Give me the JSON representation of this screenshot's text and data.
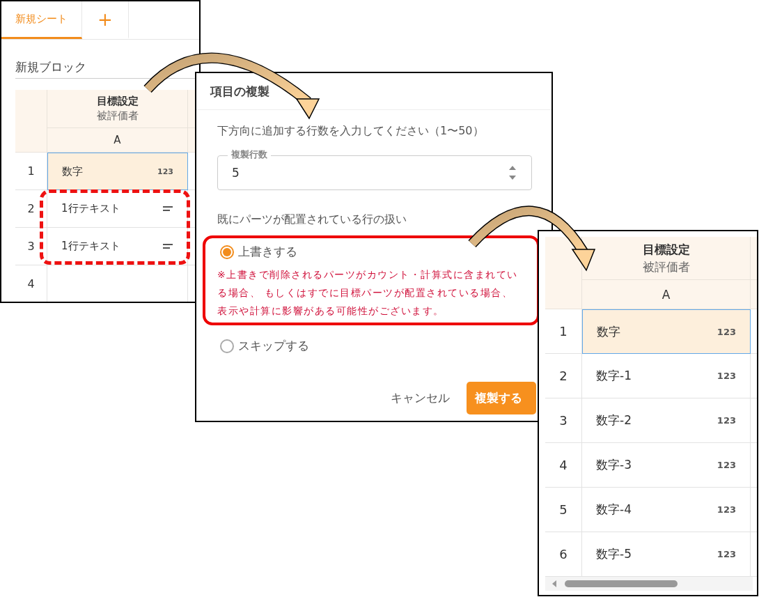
{
  "sheet_panel": {
    "tabs": [
      {
        "label": "新規シート",
        "selected": true
      },
      {
        "label": "+",
        "selected": false
      }
    ],
    "block_title": "新規ブロック",
    "table": {
      "header_title": "目標設定",
      "header_subtitle": "被評価者",
      "column": "A",
      "rows": [
        {
          "number": "1",
          "kind": "number",
          "value": "数字",
          "badge": "123",
          "selected": true
        },
        {
          "number": "2",
          "kind": "text",
          "value": "1行テキスト",
          "selected": false
        },
        {
          "number": "3",
          "kind": "text",
          "value": "1行テキスト",
          "selected": false
        },
        {
          "number": "4",
          "kind": "empty",
          "selected": false
        }
      ]
    }
  },
  "dialog": {
    "title": "項目の複製",
    "prompt": "下方向に追加する行数を入力してください（1〜50）",
    "field": {
      "label": "複製行数",
      "value": "5"
    },
    "section_label": "既にパーツが配置されている行の扱い",
    "options": [
      {
        "label": "上書きする",
        "selected": true,
        "note": "※上書きで削除されるパーツがカウント・計算式に含まれている場合、 もしくはすでに目標パーツが配置されている場合、表示や計算に影響がある可能性がございます。"
      },
      {
        "label": "スキップする",
        "selected": false
      }
    ],
    "buttons": [
      {
        "label": "キャンセル",
        "kind": "text"
      },
      {
        "label": "複製する",
        "kind": "primary"
      }
    ]
  },
  "result_panel": {
    "table": {
      "header_title": "目標設定",
      "header_subtitle": "被評価者",
      "column": "A",
      "rows": [
        {
          "number": "1",
          "kind": "number",
          "value": "数字",
          "badge": "123",
          "selected": true
        },
        {
          "number": "2",
          "kind": "number",
          "value": "数字-1",
          "badge": "123",
          "selected": false
        },
        {
          "number": "3",
          "kind": "number",
          "value": "数字-2",
          "badge": "123",
          "selected": false
        },
        {
          "number": "4",
          "kind": "number",
          "value": "数字-3",
          "badge": "123",
          "selected": false
        },
        {
          "number": "5",
          "kind": "number",
          "value": "数字-4",
          "badge": "123",
          "selected": false
        },
        {
          "number": "6",
          "kind": "number",
          "value": "数字-5",
          "badge": "123",
          "selected": false
        }
      ]
    }
  }
}
